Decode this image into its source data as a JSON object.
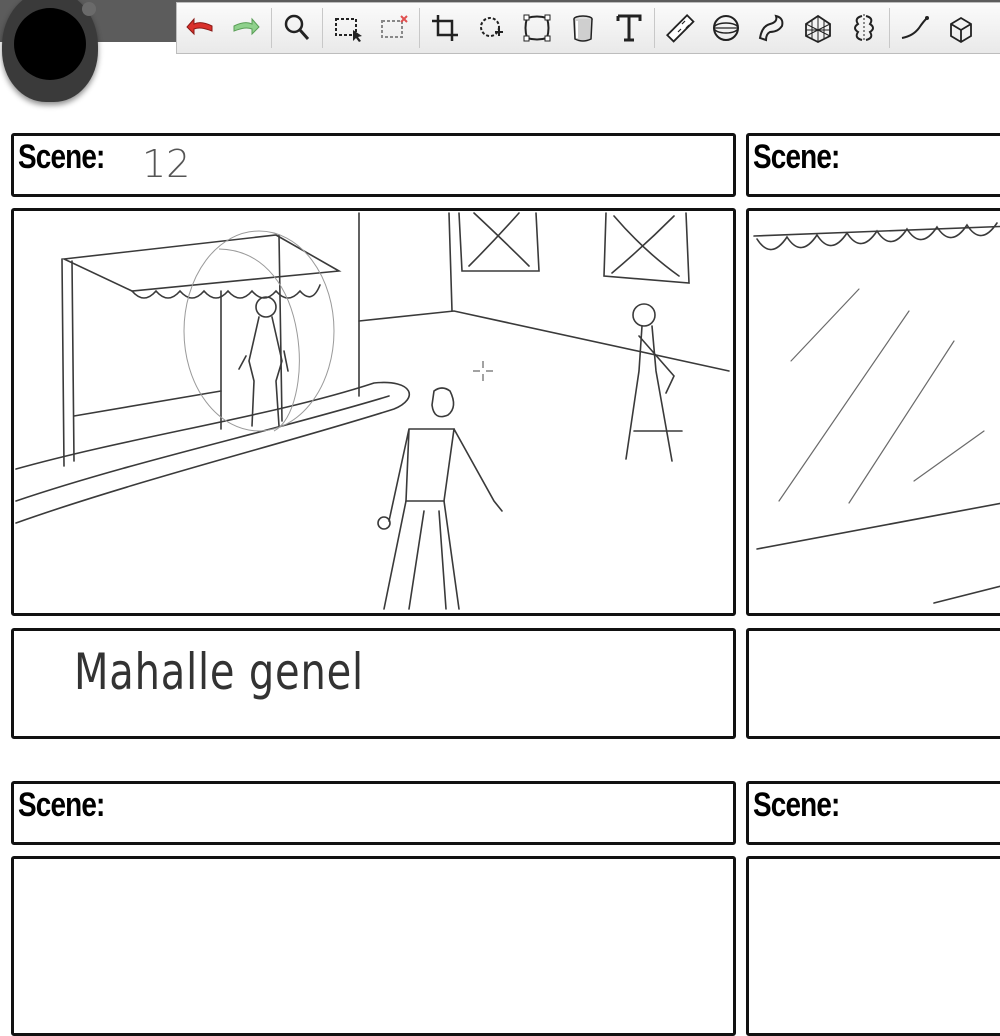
{
  "toolbar": {
    "tools": [
      {
        "icon": "undo-icon",
        "label": "Undo"
      },
      {
        "icon": "redo-icon",
        "label": "Redo"
      },
      {
        "icon": "zoom-icon",
        "label": "Zoom"
      },
      {
        "icon": "marquee-select-icon",
        "label": "Select"
      },
      {
        "icon": "clear-selection-icon",
        "label": "Clear selection"
      },
      {
        "icon": "crop-icon",
        "label": "Crop"
      },
      {
        "icon": "transform-icon",
        "label": "Transform"
      },
      {
        "icon": "warp-icon",
        "label": "Warp"
      },
      {
        "icon": "bucket-fill-icon",
        "label": "Fill"
      },
      {
        "icon": "text-icon",
        "label": "Text"
      },
      {
        "icon": "ruler-icon",
        "label": "Ruler"
      },
      {
        "icon": "ellipse-guide-icon",
        "label": "Ellipse guide"
      },
      {
        "icon": "french-curve-icon",
        "label": "French curve"
      },
      {
        "icon": "perspective-guide-icon",
        "label": "Perspective guide"
      },
      {
        "icon": "symmetry-icon",
        "label": "Symmetry"
      },
      {
        "icon": "stroke-icon",
        "label": "Steady stroke"
      },
      {
        "icon": "cube-icon",
        "label": "3D"
      }
    ]
  },
  "storyboard": {
    "panels": [
      {
        "scene_label": "Scene:",
        "scene_number": "12",
        "notes": "Mahalle   genel"
      },
      {
        "scene_label": "Scene:",
        "scene_number": "",
        "notes": ""
      },
      {
        "scene_label": "Scene:",
        "scene_number": "",
        "notes": ""
      },
      {
        "scene_label": "Scene:",
        "scene_number": "",
        "notes": ""
      }
    ]
  },
  "colors": {
    "undo": "#d9302b",
    "redo": "#8fd18c",
    "frame": "#111111",
    "pencil": "#3a3a3a"
  }
}
